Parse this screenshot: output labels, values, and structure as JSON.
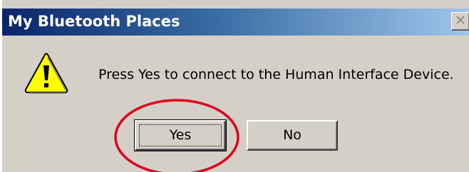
{
  "dialog": {
    "title": "My Bluetooth Places",
    "close_glyph": "✕",
    "icon": "warning-icon",
    "message": "Press Yes to connect to the Human Interface Device.",
    "buttons": {
      "yes_label": "Yes",
      "no_label": "No"
    }
  },
  "colors": {
    "titlebar_start": "#0a246a",
    "titlebar_end": "#a6caf0",
    "dialog_bg": "#d4d0c8",
    "warning_fill": "#ffff00",
    "annotation_circle": "#e0001b"
  }
}
